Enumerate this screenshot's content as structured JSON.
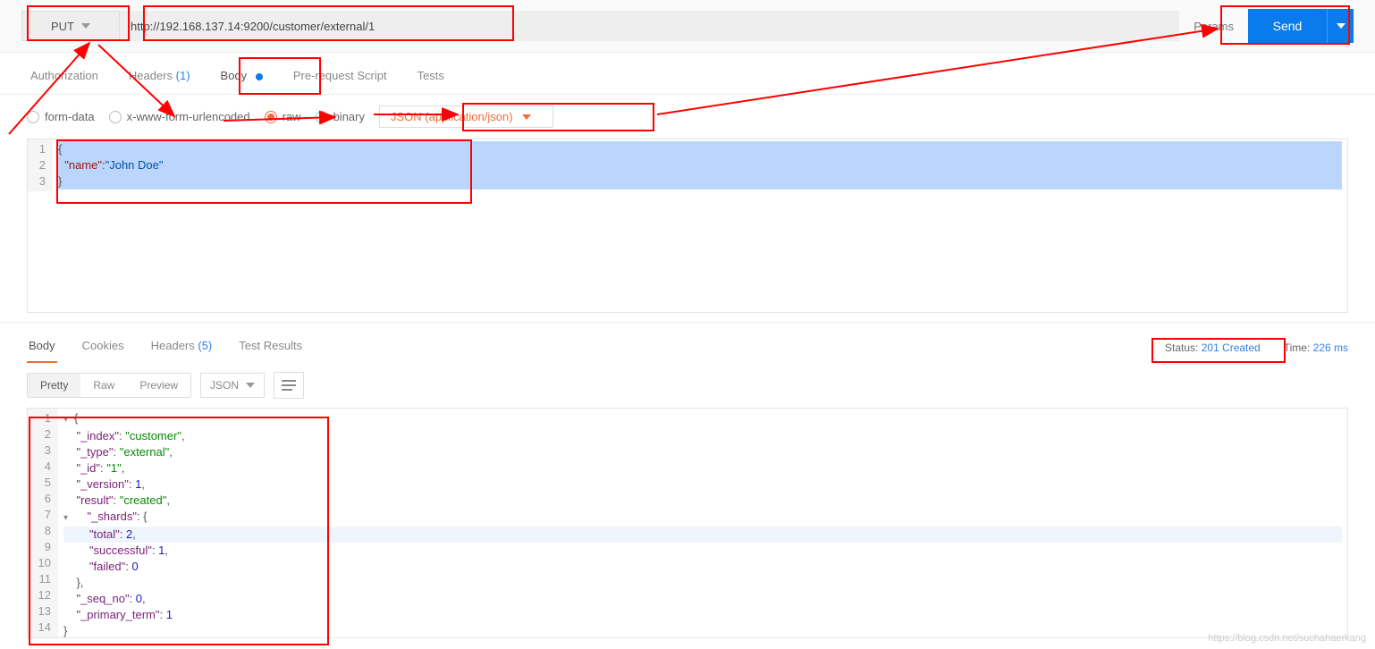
{
  "request": {
    "method": "PUT",
    "url": "http://192.168.137.14:9200/customer/external/1",
    "params_btn": "Params",
    "send_btn": "Send"
  },
  "tabs": {
    "authorization": "Authorization",
    "headers": "Headers",
    "headers_count": "(1)",
    "body": "Body",
    "prerequest": "Pre-request Script",
    "tests": "Tests"
  },
  "body_options": {
    "form_data": "form-data",
    "urlencoded": "x-www-form-urlencoded",
    "raw": "raw",
    "binary": "binary",
    "content_type": "JSON (application/json)"
  },
  "request_body_lines": [
    "{",
    "  \"name\":\"John Doe\"",
    "}"
  ],
  "response_tabs": {
    "body": "Body",
    "cookies": "Cookies",
    "headers": "Headers",
    "headers_count": "(5)",
    "test_results": "Test Results"
  },
  "response_meta": {
    "status_label": "Status:",
    "status_value": "201 Created",
    "time_label": "Time:",
    "time_value": "226 ms"
  },
  "response_toolbar": {
    "pretty": "Pretty",
    "raw": "Raw",
    "preview": "Preview",
    "format": "JSON"
  },
  "response_body_lines": [
    "{",
    "    \"_index\": \"customer\",",
    "    \"_type\": \"external\",",
    "    \"_id\": \"1\",",
    "    \"_version\": 1,",
    "    \"result\": \"created\",",
    "    \"_shards\": {",
    "        \"total\": 2,",
    "        \"successful\": 1,",
    "        \"failed\": 0",
    "    },",
    "    \"_seq_no\": 0,",
    "    \"_primary_term\": 1",
    "}"
  ],
  "watermark": "https://blog.csdn.net/suchahaerkang"
}
